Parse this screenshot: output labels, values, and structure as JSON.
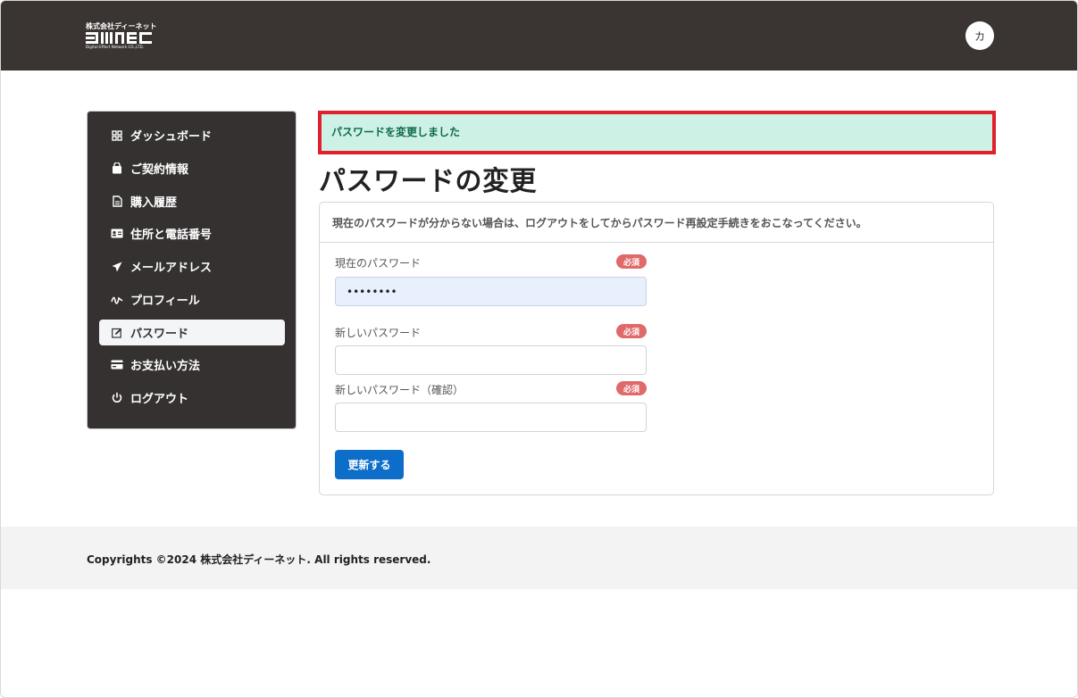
{
  "header": {
    "logo_company": "株式会社ディーネット",
    "logo_tagline": "Digital-Effect Network CO.,LTD.",
    "avatar_initial": "カ"
  },
  "sidebar": {
    "items": [
      {
        "label": "ダッシュボード",
        "icon": "dashboard-grid-icon"
      },
      {
        "label": "ご契約情報",
        "icon": "shopping-bag-icon"
      },
      {
        "label": "購入履歴",
        "icon": "document-icon"
      },
      {
        "label": "住所と電話番号",
        "icon": "id-card-icon"
      },
      {
        "label": "メールアドレス",
        "icon": "paper-plane-icon"
      },
      {
        "label": "プロフィール",
        "icon": "signature-icon"
      },
      {
        "label": "パスワード",
        "icon": "edit-icon",
        "active": true
      },
      {
        "label": "お支払い方法",
        "icon": "credit-card-icon"
      },
      {
        "label": "ログアウト",
        "icon": "power-icon"
      }
    ]
  },
  "alert": {
    "message": "パスワードを変更しました"
  },
  "page": {
    "title": "パスワードの変更"
  },
  "form": {
    "note": "現在のパスワードが分からない場合は、ログアウトをしてからパスワード再設定手続きをおこなってください。",
    "required_badge": "必須",
    "current_password": {
      "label": "現在のパスワード",
      "value": "••••••••"
    },
    "new_password": {
      "label": "新しいパスワード",
      "value": ""
    },
    "confirm_password": {
      "label": "新しいパスワード（確認）",
      "value": ""
    },
    "submit_label": "更新する"
  },
  "footer": {
    "copyright": "Copyrights ©2024 株式会社ディーネット. All rights reserved."
  },
  "colors": {
    "header_bg": "#3a3533",
    "sidebar_bg": "#343130",
    "alert_bg": "#cdf1e4",
    "alert_border": "#e0202a",
    "primary_button": "#0d6ec9",
    "required_badge": "#e06a6a"
  }
}
